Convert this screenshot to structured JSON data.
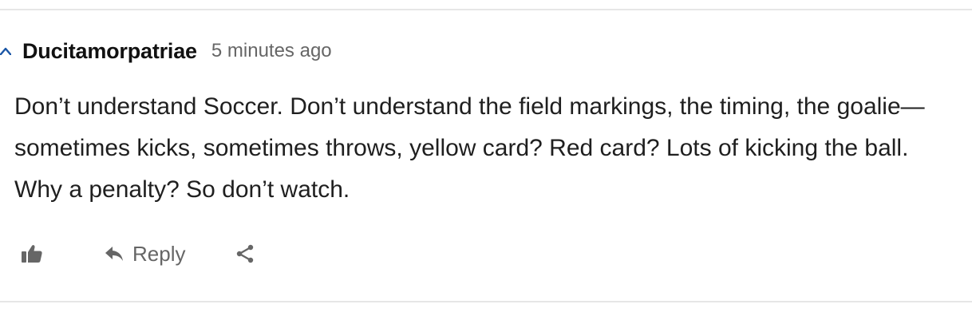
{
  "comment": {
    "username": "Ducitamorpatriae",
    "timestamp": "5 minutes ago",
    "text": "Don’t understand Soccer. Don’t understand the field markings, the timing, the goalie—sometimes kicks, sometimes throws, yellow card? Red card? Lots of kicking the ball. Why a penalty? So don’t watch.",
    "actions": {
      "like_icon": "thumbs-up-icon",
      "reply_icon": "reply-arrow-icon",
      "reply_label": "Reply",
      "share_icon": "share-icon"
    },
    "collapse_icon": "caret-up-icon"
  },
  "colors": {
    "accent": "#1955a5",
    "muted": "#666666",
    "divider": "#e6e6e6"
  }
}
